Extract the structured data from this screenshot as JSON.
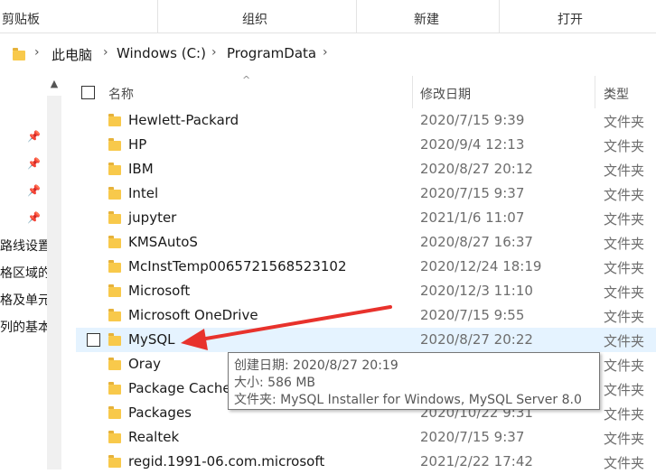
{
  "ribbon": {
    "clipboard": "剪贴板",
    "organize": "组织",
    "new": "新建",
    "open": "打开"
  },
  "address": {
    "crumbs": [
      "此电脑",
      "Windows (C:)",
      "ProgramData"
    ]
  },
  "nav": {
    "items": [
      "路线设置",
      "格区域的",
      "格及单元",
      "列的基本"
    ]
  },
  "columns": {
    "name": "名称",
    "date": "修改日期",
    "type": "类型"
  },
  "rows": [
    {
      "name": "Hewlett-Packard",
      "date": "2020/7/15 9:39",
      "type": "文件夹"
    },
    {
      "name": "HP",
      "date": "2020/9/4 12:13",
      "type": "文件夹"
    },
    {
      "name": "IBM",
      "date": "2020/8/27 20:12",
      "type": "文件夹"
    },
    {
      "name": "Intel",
      "date": "2020/7/15 9:37",
      "type": "文件夹"
    },
    {
      "name": "jupyter",
      "date": "2021/1/6 11:07",
      "type": "文件夹"
    },
    {
      "name": "KMSAutoS",
      "date": "2020/8/27 16:37",
      "type": "文件夹"
    },
    {
      "name": "McInstTemp0065721568523102",
      "date": "2020/12/24 18:19",
      "type": "文件夹"
    },
    {
      "name": "Microsoft",
      "date": "2020/12/3 11:10",
      "type": "文件夹"
    },
    {
      "name": "Microsoft OneDrive",
      "date": "2020/7/15 9:55",
      "type": "文件夹"
    },
    {
      "name": "MySQL",
      "date": "2020/8/27 20:22",
      "type": "文件夹"
    },
    {
      "name": "Oray",
      "date": "",
      "type": "文件夹"
    },
    {
      "name": "Package Cache",
      "date": "",
      "type": "文件夹"
    },
    {
      "name": "Packages",
      "date": "2020/10/22 9:31",
      "type": "文件夹"
    },
    {
      "name": "Realtek",
      "date": "2020/7/15 9:37",
      "type": "文件夹"
    },
    {
      "name": "regid.1991-06.com.microsoft",
      "date": "2021/2/22 17:42",
      "type": "文件夹"
    }
  ],
  "tooltip": {
    "created": "创建日期: 2020/8/27 20:19",
    "size": "大小: 586 MB",
    "folders": "文件夹: MySQL Installer for Windows, MySQL Server 8.0"
  },
  "colors": {
    "folder": "#f8c94b",
    "selected_row": "#e5f3ff",
    "annotation_arrow": "#e8322c"
  }
}
